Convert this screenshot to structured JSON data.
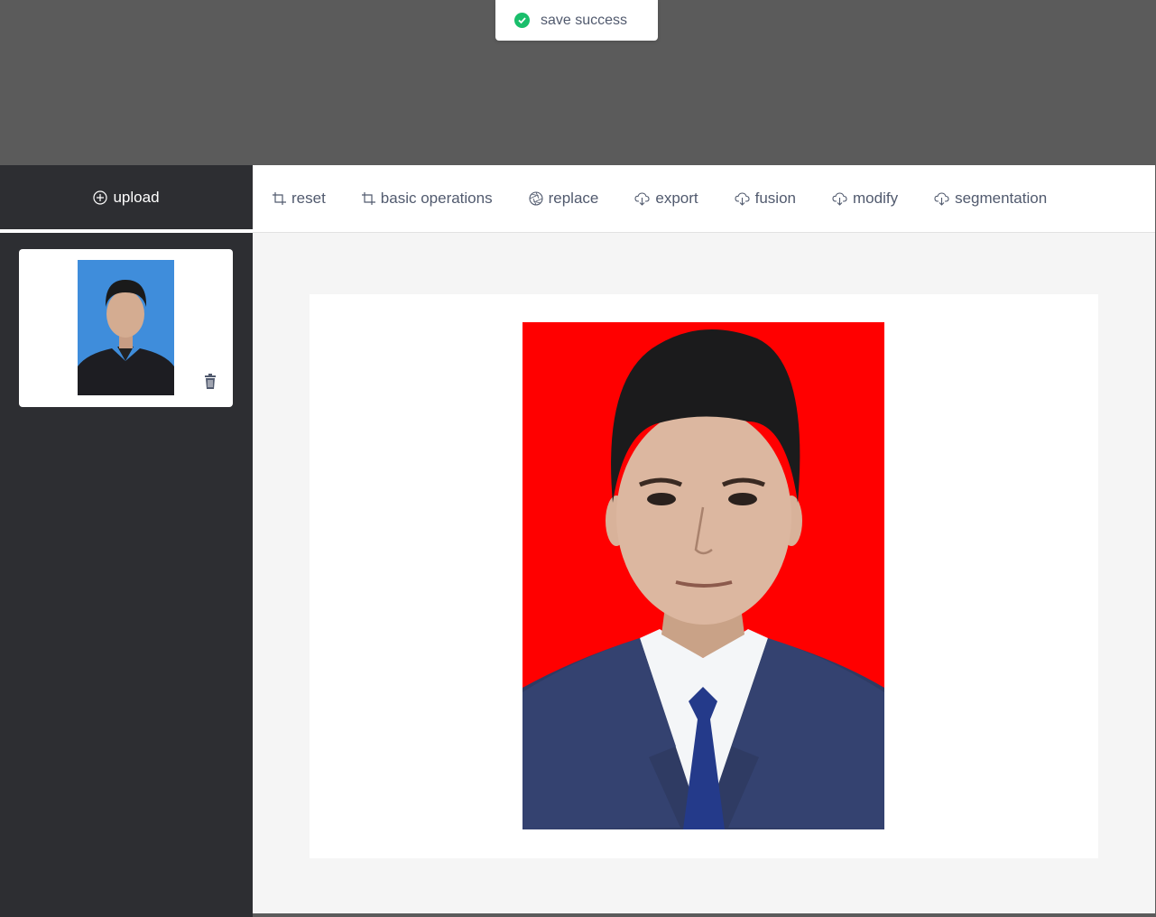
{
  "toast": {
    "message": "save success",
    "icon": "check-circle-icon",
    "color": "#19be6b"
  },
  "sidebar": {
    "upload_label": "upload",
    "upload_icon": "plus-circle-icon",
    "thumbnails": [
      {
        "background": "#3f8ddb",
        "delete_icon": "trash-icon"
      }
    ]
  },
  "toolbar": {
    "items": [
      {
        "label": "reset",
        "icon": "crop-icon"
      },
      {
        "label": "basic operations",
        "icon": "crop-icon"
      },
      {
        "label": "replace",
        "icon": "aperture-icon"
      },
      {
        "label": "export",
        "icon": "cloud-download-icon"
      },
      {
        "label": "fusion",
        "icon": "cloud-download-icon"
      },
      {
        "label": "modify",
        "icon": "cloud-download-icon"
      },
      {
        "label": "segmentation",
        "icon": "cloud-download-icon"
      }
    ]
  },
  "canvas": {
    "photo_background": "#ff0000"
  },
  "colors": {
    "sidebar": "#2d2e32",
    "overlay": "#5b5b5b",
    "workspace": "#f5f5f5",
    "text": "#515a6e"
  }
}
